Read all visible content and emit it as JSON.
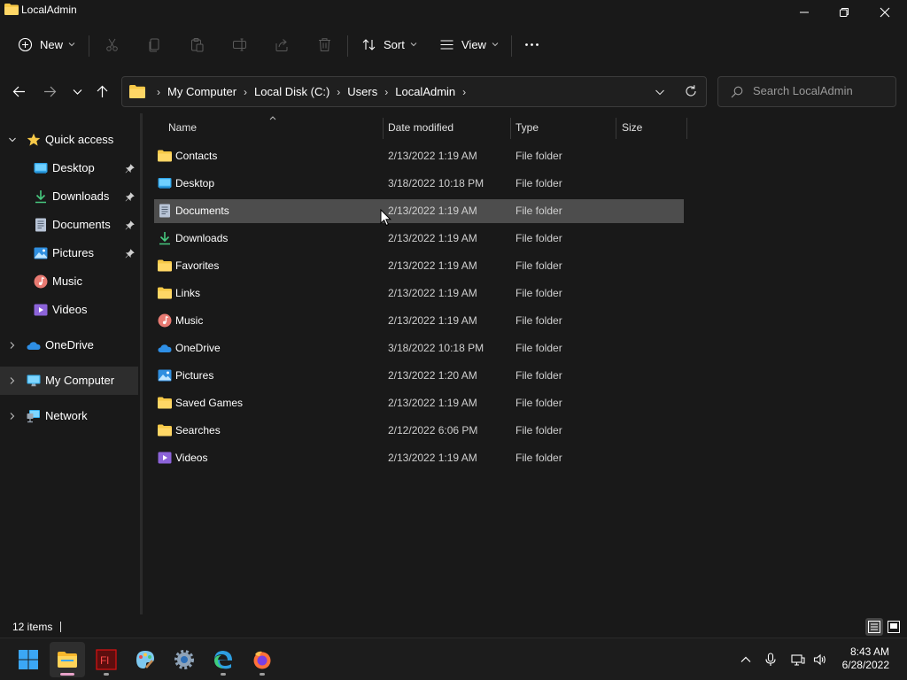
{
  "window": {
    "title": "LocalAdmin"
  },
  "toolbar": {
    "new_label": "New",
    "sort_label": "Sort",
    "view_label": "View"
  },
  "address": {
    "crumbs": [
      "My Computer",
      "Local Disk (C:)",
      "Users",
      "LocalAdmin"
    ]
  },
  "search": {
    "placeholder": "Search LocalAdmin"
  },
  "sidebar": {
    "quick_access": "Quick access",
    "items": [
      {
        "label": "Desktop",
        "icon": "desktop-icon",
        "pinned": true
      },
      {
        "label": "Downloads",
        "icon": "download-icon",
        "pinned": true
      },
      {
        "label": "Documents",
        "icon": "document-icon",
        "pinned": true
      },
      {
        "label": "Pictures",
        "icon": "pictures-icon",
        "pinned": true
      },
      {
        "label": "Music",
        "icon": "music-icon",
        "pinned": false
      },
      {
        "label": "Videos",
        "icon": "videos-icon",
        "pinned": false
      }
    ],
    "onedrive": "OneDrive",
    "my_computer": "My Computer",
    "network": "Network"
  },
  "columns": {
    "name": "Name",
    "date": "Date modified",
    "type": "Type",
    "size": "Size"
  },
  "files": [
    {
      "name": "Contacts",
      "date": "2/13/2022 1:19 AM",
      "type": "File folder",
      "icon": "folder-icon"
    },
    {
      "name": "Desktop",
      "date": "3/18/2022 10:18 PM",
      "type": "File folder",
      "icon": "desktop-icon"
    },
    {
      "name": "Documents",
      "date": "2/13/2022 1:19 AM",
      "type": "File folder",
      "icon": "document-icon"
    },
    {
      "name": "Downloads",
      "date": "2/13/2022 1:19 AM",
      "type": "File folder",
      "icon": "download-icon"
    },
    {
      "name": "Favorites",
      "date": "2/13/2022 1:19 AM",
      "type": "File folder",
      "icon": "folder-icon"
    },
    {
      "name": "Links",
      "date": "2/13/2022 1:19 AM",
      "type": "File folder",
      "icon": "folder-icon"
    },
    {
      "name": "Music",
      "date": "2/13/2022 1:19 AM",
      "type": "File folder",
      "icon": "music-icon"
    },
    {
      "name": "OneDrive",
      "date": "3/18/2022 10:18 PM",
      "type": "File folder",
      "icon": "onedrive-icon"
    },
    {
      "name": "Pictures",
      "date": "2/13/2022 1:20 AM",
      "type": "File folder",
      "icon": "pictures-icon"
    },
    {
      "name": "Saved Games",
      "date": "2/13/2022 1:19 AM",
      "type": "File folder",
      "icon": "folder-icon"
    },
    {
      "name": "Searches",
      "date": "2/12/2022 6:06 PM",
      "type": "File folder",
      "icon": "folder-icon"
    },
    {
      "name": "Videos",
      "date": "2/13/2022 1:19 AM",
      "type": "File folder",
      "icon": "videos-icon"
    }
  ],
  "status": {
    "item_count": "12 items"
  },
  "taskbar": {
    "apps": [
      "start-icon",
      "file-explorer-icon",
      "flash-icon",
      "paint-icon",
      "settings-icon",
      "edge-icon",
      "firefox-icon"
    ],
    "time": "8:43 AM",
    "date": "6/28/2022"
  },
  "colors": {
    "background": "#191919",
    "hover_row": "#4d4d4d",
    "folder": "#f7c948",
    "accent": "#4cc2ff"
  }
}
